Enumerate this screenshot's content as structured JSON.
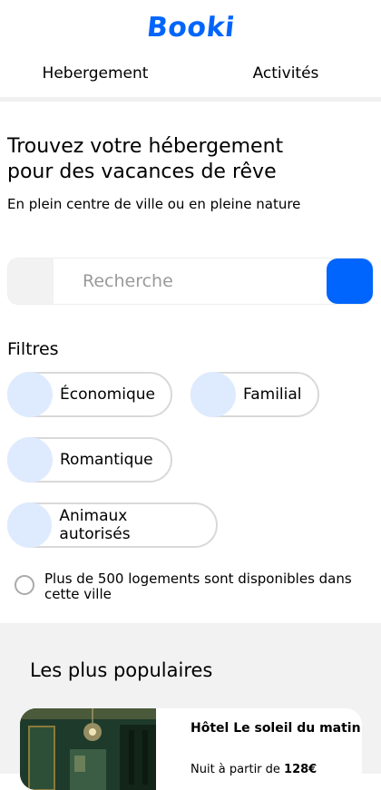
{
  "header": {
    "logo": "Booki"
  },
  "nav": {
    "items": [
      "Hebergement",
      "Activités"
    ]
  },
  "hero": {
    "title_line1": "Trouvez votre hébergement",
    "title_line2": "pour des vacances de rêve",
    "subtitle": "En plein centre de ville ou en pleine nature"
  },
  "search": {
    "placeholder": "Recherche"
  },
  "filters": {
    "title": "Filtres",
    "chips": [
      "Économique",
      "Familial",
      "Romantique",
      "Animaux autorisés"
    ]
  },
  "info": {
    "text": "Plus de 500 logements sont disponibles dans cette ville"
  },
  "popular": {
    "title": "Les plus populaires",
    "card": {
      "name": "Hôtel Le soleil du matin",
      "price_prefix": "Nuit à partir de ",
      "price": "128€"
    }
  },
  "colors": {
    "accent": "#0065FC",
    "chip_dot": "#DEEBFF",
    "section_bg": "#F2F2F2"
  }
}
